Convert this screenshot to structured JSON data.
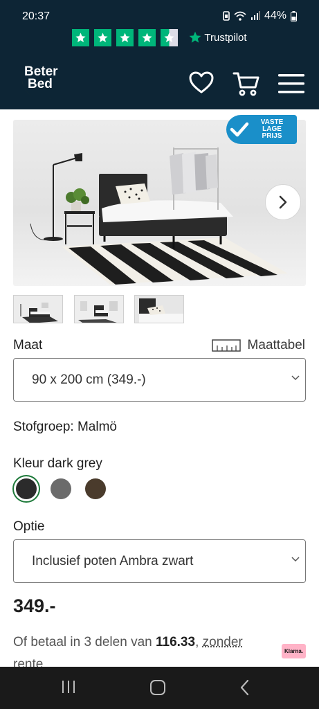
{
  "status": {
    "time": "20:37",
    "battery": "44%"
  },
  "trustpilot": {
    "brand": "Trustpilot",
    "stars": 4.5
  },
  "header": {
    "logo_line1": "Beter",
    "logo_line2": "Bed",
    "icons": [
      "heart-icon",
      "cart-icon",
      "menu-icon"
    ]
  },
  "gallery": {
    "badge_line1": "VASTE",
    "badge_line2": "LAGE",
    "badge_line3": "PRIJS",
    "thumbnail_count": 3
  },
  "size": {
    "label": "Maat",
    "size_table_label": "Maattabel",
    "selected": "90 x 200 cm (349.-)"
  },
  "fabric": {
    "text": "Stofgroep: Malmö"
  },
  "color": {
    "label": "Kleur dark grey",
    "swatches": [
      "#2b2b2b",
      "#6b6b6b",
      "#4a3b2c"
    ],
    "selected_index": 0
  },
  "option": {
    "label": "Optie",
    "selected": "Inclusief poten Ambra zwart"
  },
  "price": {
    "amount": "349.-"
  },
  "payment": {
    "prefix": "Of betaal in 3 delen van ",
    "installment": "116.33",
    "separator": ", ",
    "link1": "zonder",
    "link2": "rente",
    "provider": "Klarna."
  },
  "colors": {
    "navy": "#0d2535",
    "trustpilot_green": "#00b67a",
    "moon_yellow": "#f5b800",
    "badge_blue": "#1a8fc9",
    "selected_ring": "#1e7a3a",
    "klarna_pink": "#ffb3c7"
  }
}
